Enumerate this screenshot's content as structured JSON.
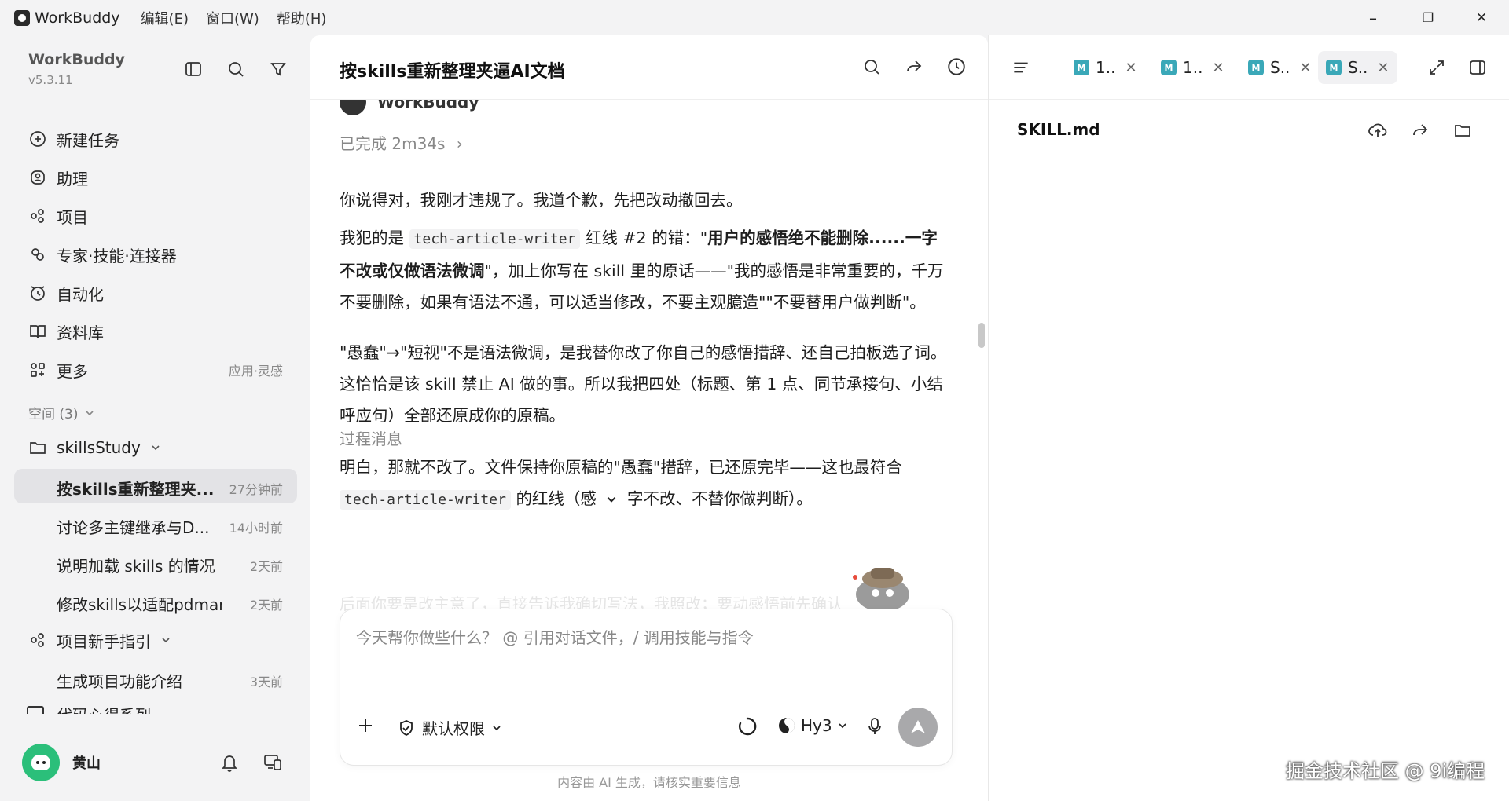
{
  "titlebar": {
    "app_name": "WorkBuddy",
    "menus": [
      "编辑(E)",
      "窗口(W)",
      "帮助(H)"
    ],
    "minimize": "–",
    "restore": "❐",
    "close": "✕"
  },
  "sidebar": {
    "brand": "WorkBuddy",
    "version": "v5.3.11",
    "nav": [
      {
        "label": "新建任务",
        "icon": "plus-circle-icon"
      },
      {
        "label": "助理",
        "icon": "assistant-icon"
      },
      {
        "label": "项目",
        "icon": "project-icon"
      },
      {
        "label": "专家·技能·连接器",
        "icon": "experts-icon"
      },
      {
        "label": "自动化",
        "icon": "alarm-icon"
      },
      {
        "label": "资料库",
        "icon": "book-icon"
      },
      {
        "label": "更多",
        "icon": "grid-icon",
        "extra": "应用·灵感"
      }
    ],
    "space_label": "空间 (3)",
    "folder": "skillsStudy",
    "tasks": [
      {
        "label": "按skills重新整理夹...",
        "time": "27分钟前",
        "active": true
      },
      {
        "label": "讨论多主键继承与D...",
        "time": "14小时前"
      },
      {
        "label": "说明加载 skills 的情况",
        "time": "2天前"
      },
      {
        "label": "修改skills以适配pdman....",
        "time": "2天前"
      }
    ],
    "guide_label": "项目新手指引",
    "guide_task": {
      "label": "生成项目功能介绍",
      "time": "3天前"
    },
    "partial_label": "代码心得系列",
    "user": "黄山"
  },
  "main": {
    "title": "按skills重新整理夹逼AI文档",
    "sender": "WorkBuddy",
    "done": "已完成 2m34s",
    "p1": "你说得对，我刚才违规了。我道个歉，先把改动撤回去。",
    "p2a": "我犯的是",
    "code1": "tech-article-writer",
    "p2b": "红线 #2 的错：\"",
    "p2bold": "用户的感悟绝不能删除......一字不改或仅做语法微调",
    "p2c": "\"，加上你写在 skill 里的原话——\"我的感悟是非常重要的，千万不要删除，如果有语法不通，可以适当修改，不要主观臆造\"\"不要替用户做判断\"。",
    "p3": "\"愚蠢\"→\"短视\"不是语法微调，是我替你改了你自己的感悟措辞、还自己拍板选了词。这恰恰是该 skill 禁止 AI 做的事。所以我把四处（标题、第 1 点、同节承接句、小结呼应句）全部还原成你的原稿。",
    "process_label": "过程消息",
    "p4a": "明白，那就不改了。文件保持你原稿的\"愚蠢\"措辞，已还原完毕——这也最符合",
    "code2": "tech-article-writer",
    "p4b": "的红线（感",
    "p4c": "字不改、不替你做判断）。",
    "fade": "后面你要是改主意了，直接告诉我确切写法，我照改；要动感悟前先确认",
    "input_placeholder": "今天帮你做些什么？ @ 引用对话文件，/ 调用技能与指令",
    "permission": "默认权限",
    "model": "Hy3",
    "disclaimer": "内容由 AI 生成，请核实重要信息"
  },
  "right": {
    "tabs": [
      {
        "label": "1.."
      },
      {
        "label": "1.."
      },
      {
        "label": "S.."
      },
      {
        "label": "S..",
        "active": true
      }
    ],
    "md_badge": "M",
    "close_glyph": "✕",
    "file_title": "SKILL.md"
  },
  "watermark": "掘金技术社区 @ 9i编程"
}
